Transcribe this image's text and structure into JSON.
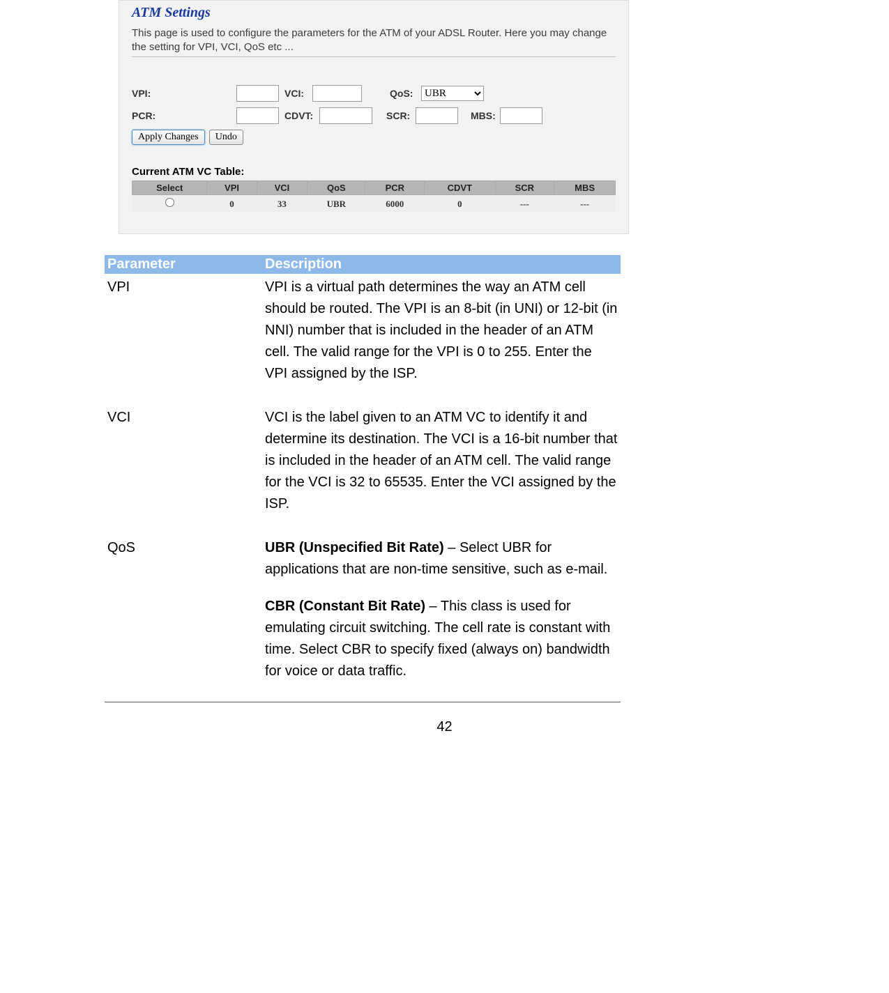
{
  "router": {
    "title": "ATM Settings",
    "desc": "This page is used to configure the parameters for the ATM of your ADSL Router. Here you may change the setting for VPI, VCI, QoS etc ...",
    "labels": {
      "vpi": "VPI:",
      "vci": "VCI:",
      "qos": "QoS:",
      "pcr": "PCR:",
      "cdvt": "CDVT:",
      "scr": "SCR:",
      "mbs": "MBS:"
    },
    "qos_selected": "UBR",
    "buttons": {
      "apply": "Apply Changes",
      "undo": "Undo"
    },
    "vc_table_title": "Current ATM VC Table:",
    "vc_headers": [
      "Select",
      "VPI",
      "VCI",
      "QoS",
      "PCR",
      "CDVT",
      "SCR",
      "MBS"
    ],
    "vc_row": {
      "vpi": "0",
      "vci": "33",
      "qos": "UBR",
      "pcr": "6000",
      "cdvt": "0",
      "scr": "---",
      "mbs": "---"
    }
  },
  "doc_table": {
    "header_param": "Parameter",
    "header_desc": "Description",
    "rows": {
      "vpi": {
        "param": "VPI",
        "desc": "VPI is a virtual path determines the way an ATM cell should be routed. The VPI is an 8-bit (in UNI) or 12-bit (in NNI) number that is included in the header of an ATM cell. The valid range for the VPI is 0 to 255. Enter the VPI assigned by the ISP."
      },
      "vci": {
        "param": "VCI",
        "desc": "VCI is the label given to an ATM VC to identify it and determine its destination. The VCI is a 16-bit number that is included in the header of an ATM cell. The valid range for the VCI is 32 to 65535. Enter the VCI assigned by the ISP."
      },
      "qos": {
        "param": "QoS",
        "ubr_bold": "UBR (Unspecified Bit Rate)",
        "ubr_rest": " – Select UBR for applications that are non-time sensitive, such as e-mail.",
        "cbr_bold": "CBR (Constant Bit Rate)",
        "cbr_rest": " – This class is used for emulating circuit switching. The cell rate is constant with time. Select CBR to specify fixed (always on) bandwidth for voice or data traffic."
      }
    }
  },
  "page_number": "42"
}
